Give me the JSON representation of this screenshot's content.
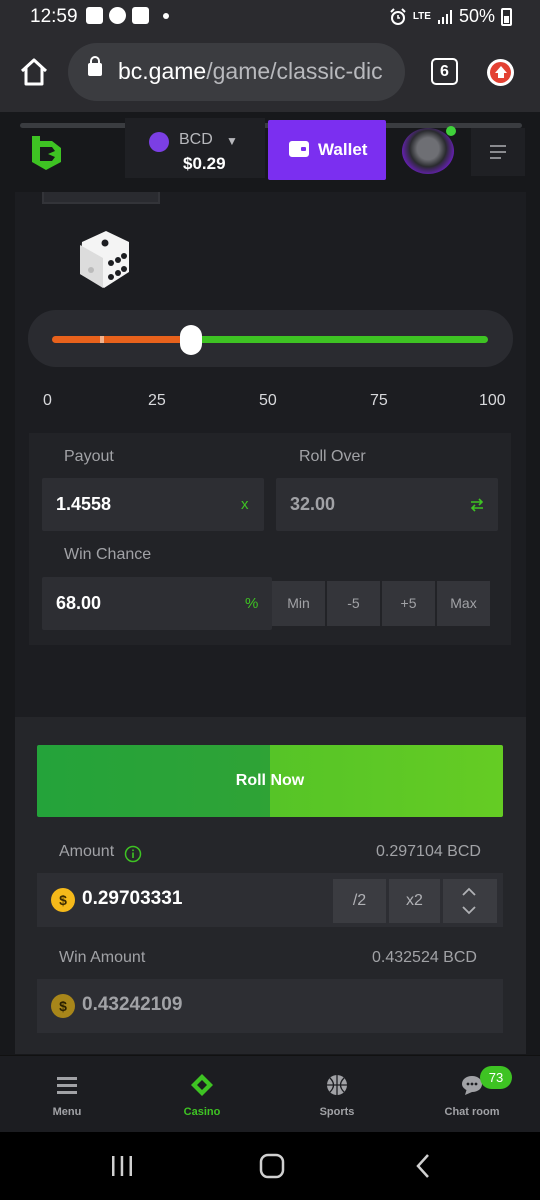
{
  "status_bar": {
    "time": "12:59",
    "network": "LTE",
    "battery": "50%"
  },
  "browser": {
    "url_host": "bc.game",
    "url_path": "/game/classic-dic",
    "tab_count": "6"
  },
  "header": {
    "currency_code": "BCD",
    "balance": "$0.29",
    "wallet_label": "Wallet"
  },
  "slider": {
    "roll_over_fraction": 0.32,
    "ticks": [
      "0",
      "25",
      "50",
      "75",
      "100"
    ]
  },
  "params": {
    "payout_label": "Payout",
    "payout_value": "1.4558",
    "payout_suffix": "x",
    "roll_over_label": "Roll Over",
    "roll_over_value": "32.00",
    "win_chance_label": "Win Chance",
    "win_chance_value": "68.00",
    "win_chance_suffix": "%",
    "buttons": [
      "Min",
      "-5",
      "+5",
      "Max"
    ]
  },
  "bet": {
    "roll_label": "Roll Now",
    "amount_label": "Amount",
    "amount_bcd": "0.297104 BCD",
    "amount_value": "0.29703331",
    "half_label": "/2",
    "double_label": "x2",
    "win_amount_label": "Win Amount",
    "win_amount_bcd": "0.432524 BCD",
    "win_amount_value": "0.43242109",
    "coin_symbol": "$"
  },
  "bottom_nav": {
    "menu": "Menu",
    "casino": "Casino",
    "sports": "Sports",
    "chat": "Chat room",
    "chat_badge": "73"
  },
  "colors": {
    "accent_green": "#3ec323",
    "accent_orange": "#e8621c",
    "wallet_purple": "#7b2ff0",
    "background": "#17181b"
  }
}
